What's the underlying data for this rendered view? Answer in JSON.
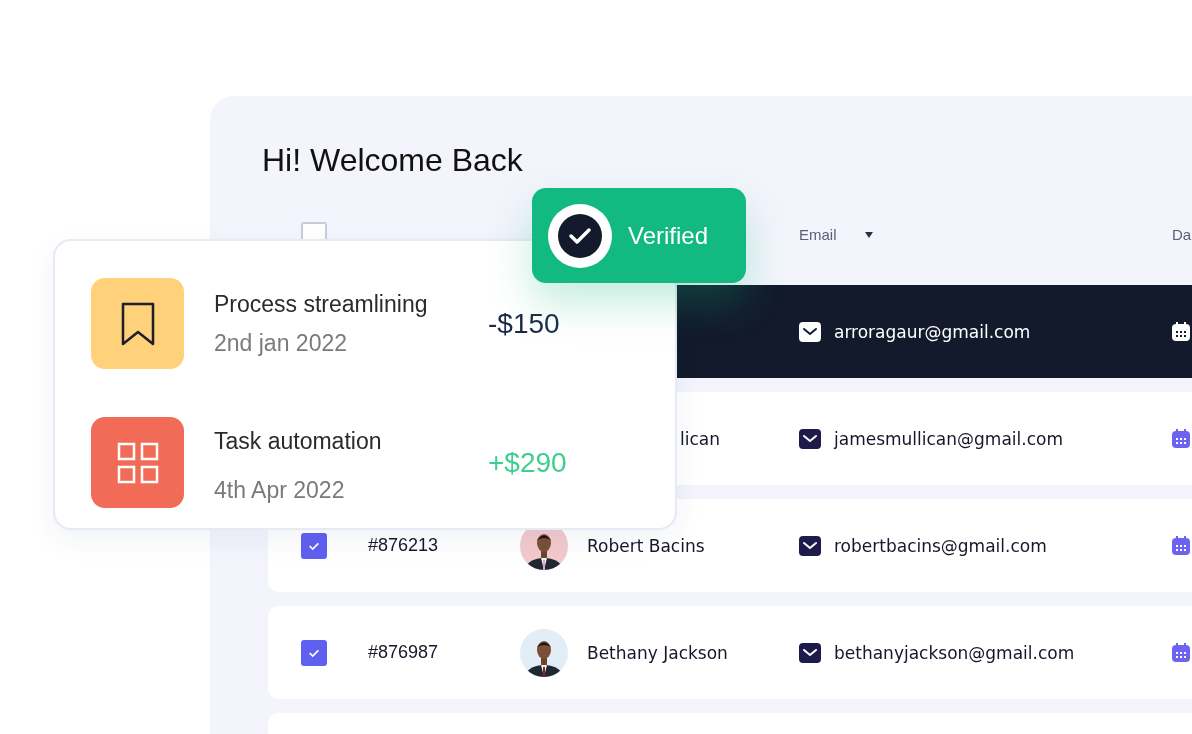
{
  "title": "Hi! Welcome Back",
  "table": {
    "header_checkbox": {
      "checked": false
    },
    "columns": [
      {
        "label": "Email",
        "sorted": true
      },
      {
        "label": "Da",
        "sorted": false
      }
    ],
    "rows": [
      {
        "selected": true,
        "email": "arroragaur@gmail.com"
      },
      {
        "selected": false,
        "name": "lican",
        "email": "jamesmullican@gmail.com"
      },
      {
        "selected": false,
        "checked": true,
        "id": "#876213",
        "name": "Robert Bacins",
        "email": "robertbacins@gmail.com"
      },
      {
        "selected": false,
        "checked": true,
        "id": "#876987",
        "name": "Bethany Jackson",
        "email": "bethanyjackson@gmail.com"
      },
      {
        "selected": false
      }
    ]
  },
  "transactions": [
    {
      "kind": "bookmark",
      "color": "#fed17a",
      "title": "Process streamlining",
      "date": "2nd jan 2022",
      "amount": {
        "text": "-$150",
        "color": "#1c2a4a"
      }
    },
    {
      "kind": "grid",
      "color": "#f26b57",
      "title": "Task automation",
      "date": "4th Apr 2022",
      "amount": {
        "text": "+$290",
        "color": "#3ecf8e"
      }
    }
  ],
  "badge": {
    "label": "Verified"
  }
}
